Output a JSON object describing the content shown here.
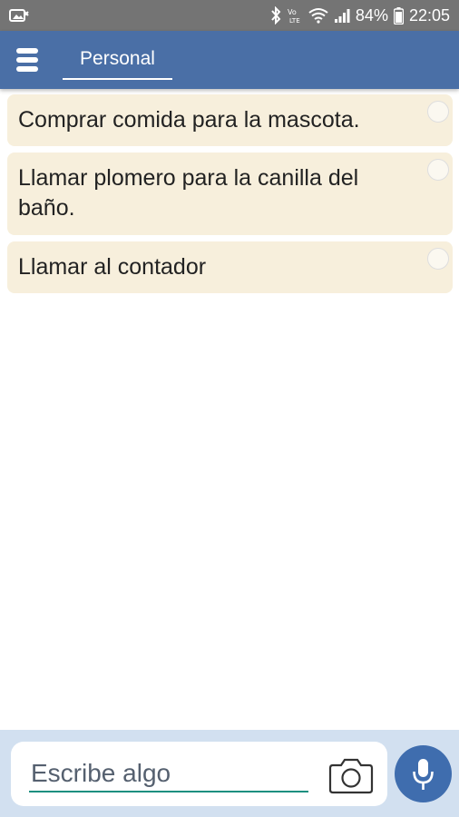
{
  "status_bar": {
    "battery": "84%",
    "time": "22:05"
  },
  "app_bar": {
    "tab_label": "Personal"
  },
  "tasks": [
    {
      "text": "Comprar comida para la mascota."
    },
    {
      "text": "Llamar plomero para la canilla del baño."
    },
    {
      "text": "Llamar al contador"
    }
  ],
  "input": {
    "placeholder": "Escribe algo",
    "value": ""
  },
  "icons": {
    "menu": "menu-icon",
    "check": "circle-check-icon",
    "camera": "camera-icon",
    "mic": "microphone-icon"
  },
  "colors": {
    "status_bar": "#747474",
    "app_bar": "#4a6fa6",
    "task_card": "#f7efdc",
    "bottom_bar": "#d2e0f0",
    "mic_button": "#3f6dae",
    "input_underline": "#1a8f7f"
  }
}
